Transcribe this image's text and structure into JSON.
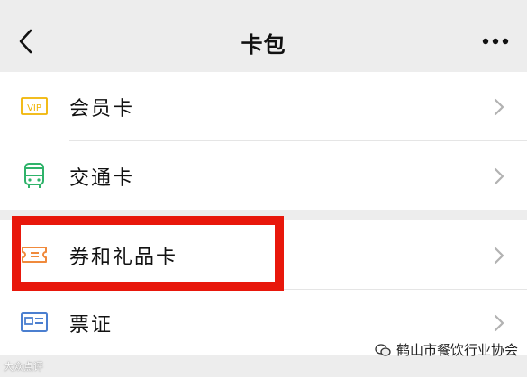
{
  "header": {
    "title": "卡包",
    "back_icon": "chevron-left-icon",
    "more_icon": "more-dots-icon"
  },
  "list": {
    "group1": [
      {
        "label": "会员卡",
        "icon": "vip-card-icon"
      },
      {
        "label": "交通卡",
        "icon": "bus-icon"
      }
    ],
    "group2": [
      {
        "label": "券和礼品卡",
        "icon": "ticket-icon"
      },
      {
        "label": "票证",
        "icon": "id-card-icon"
      }
    ]
  },
  "icons": {
    "vip_text": "VIP"
  },
  "watermark": {
    "left": "大众点评",
    "right": "鹤山市餐饮行业协会"
  },
  "colors": {
    "vip": "#f0b400",
    "bus": "#2fb36a",
    "ticket": "#f08a3c",
    "idcard": "#4b7fd0",
    "highlight": "#e8170b"
  }
}
